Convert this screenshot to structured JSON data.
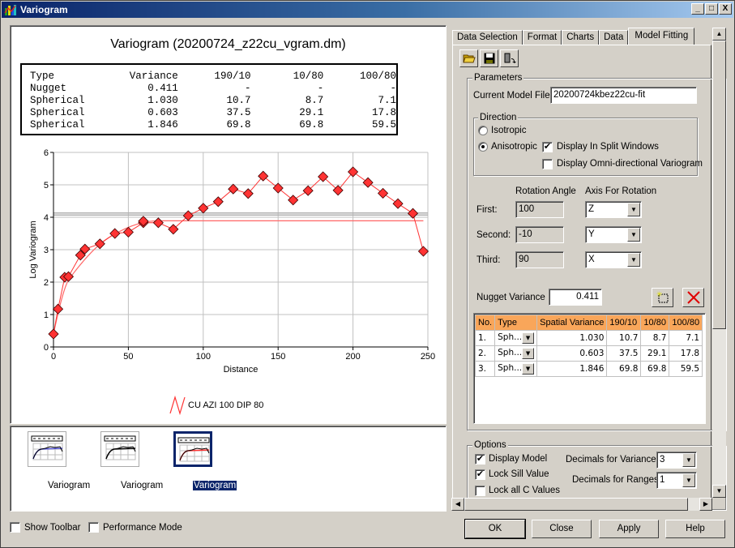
{
  "window": {
    "title": "Variogram",
    "icon": "chart-app-icon",
    "controls": [
      "minimize",
      "maximize",
      "close"
    ]
  },
  "chart": {
    "title": "Variogram (20200724_z22cu_vgram.dm)",
    "summary_table": {
      "headers": [
        "Type",
        "Variance",
        "190/10",
        "10/80",
        "100/80"
      ],
      "rows": [
        [
          "Nugget",
          "0.411",
          "-",
          "-",
          "-"
        ],
        [
          "Spherical",
          "1.030",
          "10.7",
          "8.7",
          "7.1"
        ],
        [
          "Spherical",
          "0.603",
          "37.5",
          "29.1",
          "17.8"
        ],
        [
          "Spherical",
          "1.846",
          "69.8",
          "69.8",
          "59.5"
        ]
      ]
    }
  },
  "chart_data": {
    "type": "line",
    "title": "Variogram (20200724_z22cu_vgram.dm)",
    "xlabel": "Distance",
    "ylabel": "Log Variogram",
    "xlim": [
      0,
      250
    ],
    "ylim": [
      0,
      6
    ],
    "xticks": [
      0,
      50,
      100,
      150,
      200,
      250
    ],
    "yticks": [
      0,
      1,
      2,
      3,
      4,
      5,
      6
    ],
    "grid": true,
    "legend": {
      "placement": "bottom-center",
      "entries": [
        "CU AZI 100 DIP 80"
      ]
    },
    "sill_lines": [
      4.07,
      4.13
    ],
    "series": [
      {
        "name": "CU AZI 100 DIP 80",
        "color": "#ff3333",
        "marker": "diamond",
        "x": [
          0,
          3,
          7.5,
          10,
          18,
          21,
          31,
          41,
          50,
          60,
          70,
          80,
          90,
          100,
          110,
          120,
          130,
          140,
          150,
          160,
          170,
          180,
          190,
          200,
          210,
          220,
          230,
          240,
          247
        ],
        "y": [
          0.4,
          1.17,
          2.15,
          2.17,
          2.83,
          3.02,
          3.18,
          3.5,
          3.54,
          3.83,
          3.83,
          3.63,
          4.05,
          4.28,
          4.48,
          4.87,
          4.73,
          5.27,
          4.9,
          4.53,
          4.82,
          5.25,
          4.83,
          5.4,
          5.07,
          4.74,
          4.42,
          4.12,
          2.95
        ]
      },
      {
        "name": "model",
        "color": "#ff6666",
        "model": {
          "nugget": 0.411,
          "structures": [
            {
              "type": "spherical",
              "c": 1.03,
              "range": 10.7
            },
            {
              "type": "spherical",
              "c": 0.603,
              "range": 37.5
            },
            {
              "type": "spherical",
              "c": 1.846,
              "range": 69.8
            }
          ]
        },
        "x_end": 250
      }
    ],
    "extra_points": [
      {
        "x": 60,
        "y": 3.88
      }
    ]
  },
  "thumbnails": [
    {
      "label": "Variogram",
      "selected": false,
      "accent": "#5050d0"
    },
    {
      "label": "Variogram",
      "selected": false,
      "accent": "#000000"
    },
    {
      "label": "Variogram",
      "selected": true,
      "accent": "#ff3333"
    }
  ],
  "bottom_options": {
    "show_toolbar": {
      "label": "Show Toolbar",
      "checked": false
    },
    "performance_mode": {
      "label": "Performance Mode",
      "checked": false
    }
  },
  "tabs": [
    {
      "label": "Data Selection",
      "active": false
    },
    {
      "label": "Format",
      "active": false
    },
    {
      "label": "Charts",
      "active": false
    },
    {
      "label": "Data",
      "active": false
    },
    {
      "label": "Model Fitting",
      "active": true
    }
  ],
  "toolbar": {
    "open": "open-folder-icon",
    "save": "save-icon",
    "export": "export-icon"
  },
  "parameters": {
    "group_label": "Parameters",
    "model_file_label": "Current Model File :",
    "model_file_value": "20200724kbez22cu-fit",
    "direction": {
      "group_label": "Direction",
      "isotropic": {
        "label": "Isotropic",
        "selected": false
      },
      "anisotropic": {
        "label": "Anisotropic",
        "selected": true
      },
      "split_windows": {
        "label": "Display In Split Windows",
        "checked": true
      },
      "omni": {
        "label": "Display Omni-directional Variogram",
        "checked": false
      }
    },
    "rotation": {
      "angle_header": "Rotation Angle",
      "axis_header": "Axis For Rotation",
      "rows": [
        {
          "label": "First:",
          "angle": "100",
          "axis": "Z"
        },
        {
          "label": "Second:",
          "angle": "-10",
          "axis": "Y"
        },
        {
          "label": "Third:",
          "angle": "90",
          "axis": "X"
        }
      ]
    },
    "nugget_label": "Nugget Variance :",
    "nugget_value": "0.411",
    "structures": {
      "headers": [
        "No.",
        "Type",
        "Spatial Variance",
        "190/10",
        "10/80",
        "100/80"
      ],
      "rows": [
        [
          "1.",
          "Sph...",
          "1.030",
          "10.7",
          "8.7",
          "7.1"
        ],
        [
          "2.",
          "Sph...",
          "0.603",
          "37.5",
          "29.1",
          "17.8"
        ],
        [
          "3.",
          "Sph...",
          "1.846",
          "69.8",
          "69.8",
          "59.5"
        ]
      ]
    }
  },
  "options": {
    "group_label": "Options",
    "display_model": {
      "label": "Display Model",
      "checked": true
    },
    "lock_sill": {
      "label": "Lock Sill Value",
      "checked": true
    },
    "lock_c": {
      "label": "Lock all C Values",
      "checked": false
    },
    "dec_variances_label": "Decimals for Variances",
    "dec_variances_value": "3",
    "dec_ranges_label": "Decimals for Ranges",
    "dec_ranges_value": "1"
  },
  "buttons": {
    "ok": "OK",
    "close": "Close",
    "apply": "Apply",
    "help": "Help"
  }
}
